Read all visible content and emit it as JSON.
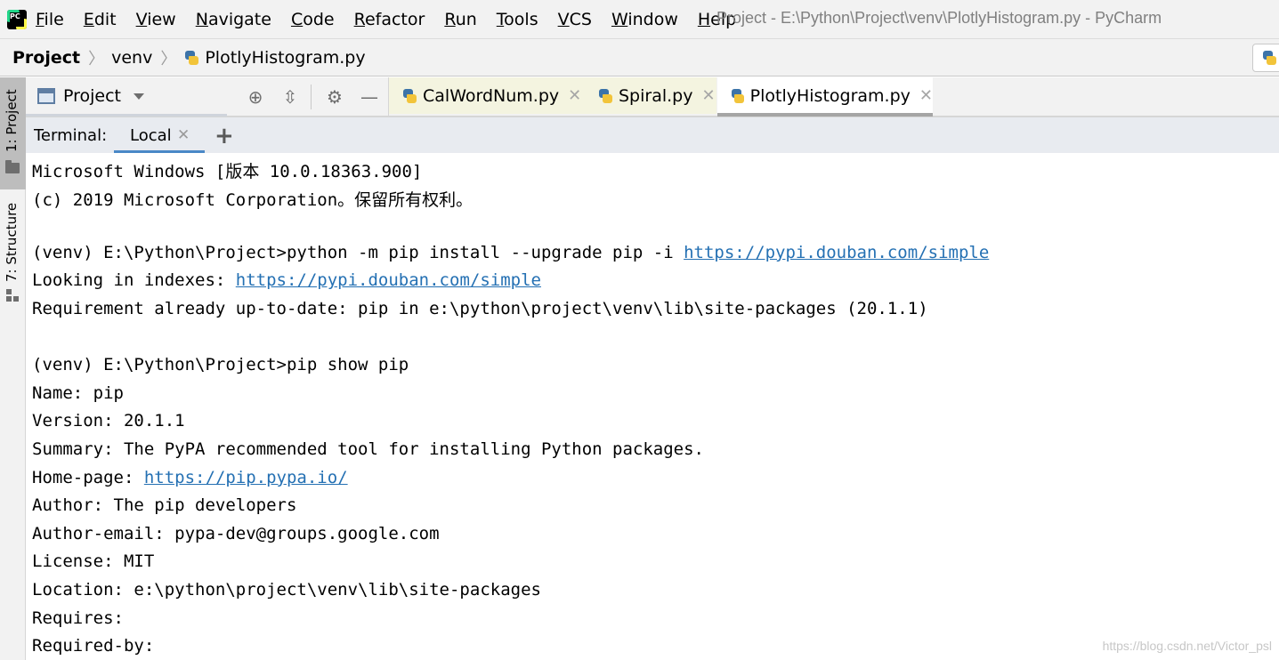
{
  "menubar": {
    "items": [
      "File",
      "Edit",
      "View",
      "Navigate",
      "Code",
      "Refactor",
      "Run",
      "Tools",
      "VCS",
      "Window",
      "Help"
    ],
    "window_title": "Project - E:\\Python\\Project\\venv\\PlotlyHistogram.py - PyCharm"
  },
  "breadcrumb": {
    "items": [
      "Project",
      "venv",
      "PlotlyHistogram.py"
    ]
  },
  "leftstrip": {
    "project_tab": "1: Project",
    "structure_tab": "7: Structure"
  },
  "project_panel": {
    "selector_label": "Project"
  },
  "editor_tabs": [
    {
      "label": "CalWordNum.py",
      "active": false
    },
    {
      "label": "Spiral.py",
      "active": false
    },
    {
      "label": "PlotlyHistogram.py",
      "active": true
    }
  ],
  "terminal": {
    "label": "Terminal:",
    "tab_label": "Local",
    "lines": [
      {
        "text": "Microsoft Windows [版本 10.0.18363.900]"
      },
      {
        "text": "(c) 2019 Microsoft Corporation。保留所有权利。"
      },
      {
        "text": ""
      },
      {
        "text": "(venv) E:\\Python\\Project>python -m pip install --upgrade pip -i ",
        "link": "https://pypi.douban.com/simple"
      },
      {
        "text": "Looking in indexes: ",
        "link": "https://pypi.douban.com/simple"
      },
      {
        "text": "Requirement already up-to-date: pip in e:\\python\\project\\venv\\lib\\site-packages (20.1.1)"
      },
      {
        "text": ""
      },
      {
        "text": "(venv) E:\\Python\\Project>pip show pip"
      },
      {
        "text": "Name: pip"
      },
      {
        "text": "Version: 20.1.1"
      },
      {
        "text": "Summary: The PyPA recommended tool for installing Python packages."
      },
      {
        "text": "Home-page: ",
        "link": "https://pip.pypa.io/"
      },
      {
        "text": "Author: The pip developers"
      },
      {
        "text": "Author-email: pypa-dev@groups.google.com"
      },
      {
        "text": "License: MIT"
      },
      {
        "text": "Location: e:\\python\\project\\venv\\lib\\site-packages"
      },
      {
        "text": "Requires:"
      },
      {
        "text": "Required-by:"
      }
    ]
  },
  "watermark": "https://blog.csdn.net/Victor_psl",
  "colors": {
    "link": "#2470b3",
    "active_tab_underline": "#4a88c7"
  }
}
